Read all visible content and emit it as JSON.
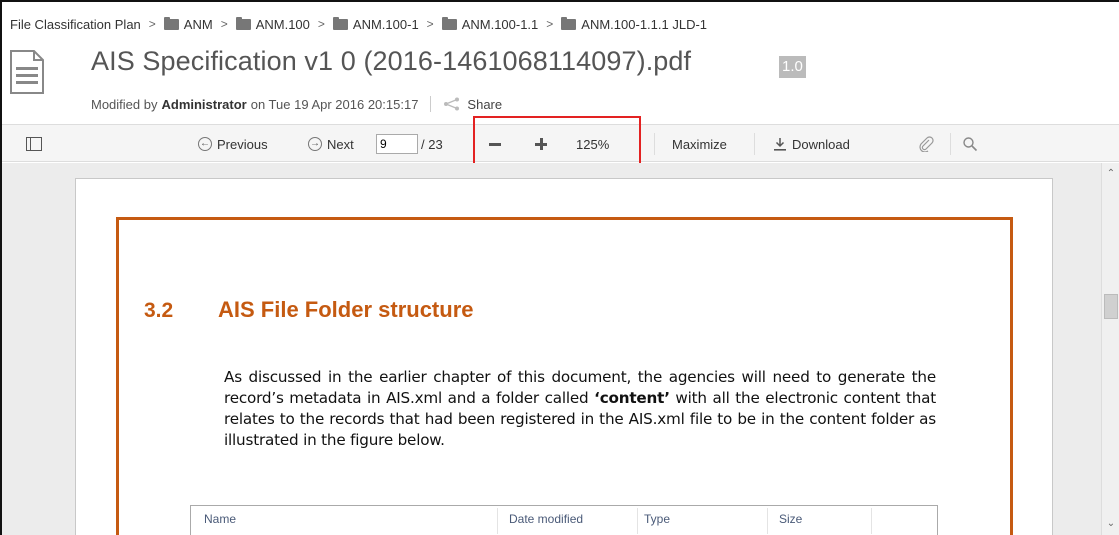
{
  "breadcrumb": {
    "root": "File Classification Plan",
    "separator": ">",
    "folders": [
      "ANM",
      "ANM.100",
      "ANM.100-1",
      "ANM.100-1.1",
      "ANM.100-1.1.1 JLD-1"
    ]
  },
  "document": {
    "title": "AIS Specification v1 0 (2016-1461068114097).pdf",
    "version": "1.0",
    "modified_prefix": "Modified by",
    "modified_by": "Administrator",
    "modified_on": "on Tue 19 Apr 2016 20:15:17",
    "share_label": "Share"
  },
  "toolbar": {
    "previous_label": "Previous",
    "next_label": "Next",
    "current_page": "9",
    "total_pages": "/ 23",
    "zoom": "125%",
    "maximize_label": "Maximize",
    "download_label": "Download"
  },
  "pdf_page": {
    "section_number": "3.2",
    "section_title": "AIS File Folder structure",
    "para_1": "As discussed in the earlier chapter of this document, the agencies will need to generate the record’s metadata in AIS.xml and a folder called ",
    "para_bold": "‘content’",
    "para_2": " with all the electronic content that relates to the records that had been registered in the AIS.xml file to be in the content folder as illustrated in the figure below.",
    "table_headers": [
      "Name",
      "Date modified",
      "Type",
      "Size"
    ]
  },
  "colors": {
    "accent_orange": "#c55a11",
    "highlight_red": "#e32222",
    "toolbar_bg": "#f5f5f5"
  }
}
